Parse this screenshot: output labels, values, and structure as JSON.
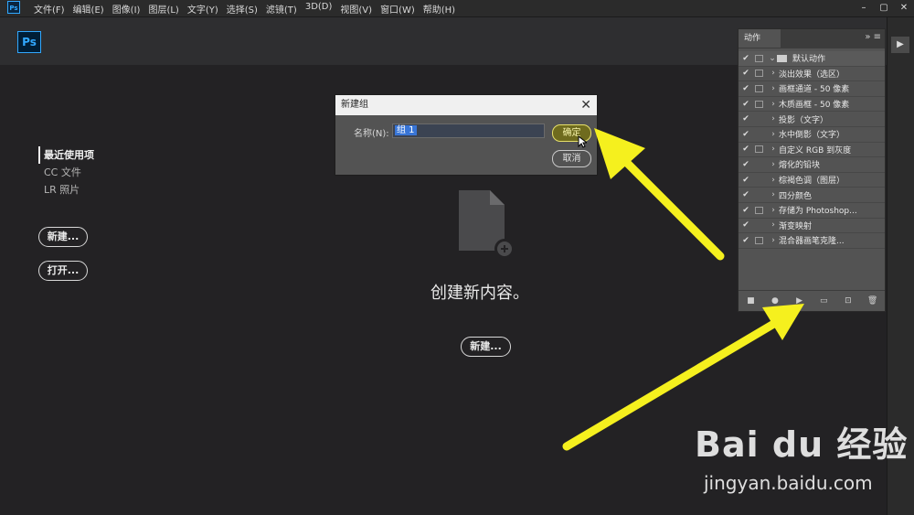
{
  "menubar": {
    "app_icon": "Ps",
    "items": [
      "文件(F)",
      "编辑(E)",
      "图像(I)",
      "图层(L)",
      "文字(Y)",
      "选择(S)",
      "滤镜(T)",
      "3D(D)",
      "视图(V)",
      "窗口(W)",
      "帮助(H)"
    ],
    "window_controls": [
      "minimize-icon",
      "restore-icon",
      "close-icon"
    ]
  },
  "home": {
    "logo": "Ps",
    "nav": [
      "最近使用项",
      "CC 文件",
      "LR 照片"
    ],
    "new_button": "新建...",
    "open_button": "打开...",
    "welcome_text": "创建新内容。",
    "center_new_button": "新建...",
    "icon": "new-document-icon"
  },
  "dialog": {
    "title": "新建组",
    "name_label": "名称(N):",
    "name_value": "组 1",
    "ok_label": "确定",
    "cancel_label": "取消"
  },
  "actions_panel": {
    "tab": "动作",
    "set_name": "默认动作",
    "actions": [
      {
        "label": "淡出效果（选区）",
        "dialog": true
      },
      {
        "label": "画框通道 - 50 像素",
        "dialog": true
      },
      {
        "label": "木质画框 - 50 像素",
        "dialog": true
      },
      {
        "label": "投影（文字）",
        "dialog": false
      },
      {
        "label": "水中倒影（文字）",
        "dialog": false
      },
      {
        "label": "自定义 RGB 到灰度",
        "dialog": true
      },
      {
        "label": "熔化的铅块",
        "dialog": false
      },
      {
        "label": "棕褐色调（图层）",
        "dialog": false
      },
      {
        "label": "四分颜色",
        "dialog": false
      },
      {
        "label": "存储为 Photoshop...",
        "dialog": true
      },
      {
        "label": "渐变映射",
        "dialog": false
      },
      {
        "label": "混合器画笔克隆...",
        "dialog": true
      }
    ],
    "footer_icons": [
      "stop-icon",
      "record-icon",
      "play-icon",
      "new-set-icon",
      "new-action-icon",
      "delete-icon"
    ]
  },
  "annotation_color": "#f5f01e",
  "watermark": {
    "brand": "Bai du 经验",
    "url": "jingyan.baidu.com"
  }
}
